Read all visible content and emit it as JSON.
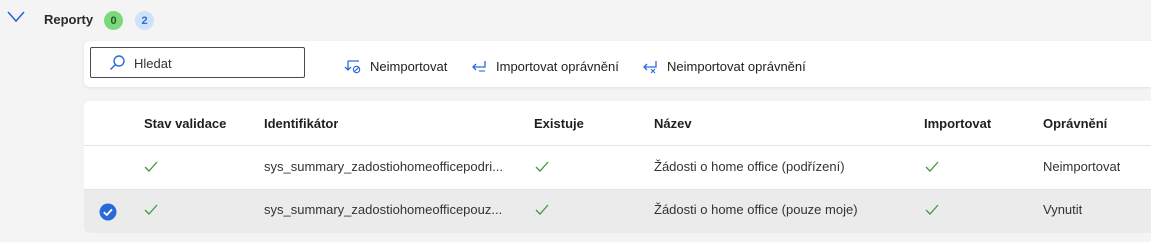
{
  "section": {
    "title": "Reporty",
    "badge_green": "0",
    "badge_blue": "2"
  },
  "toolbar": {
    "search_placeholder": "Hledat",
    "action_neimportovat": "Neimportovat",
    "action_importovat_opravneni": "Importovat oprávnění",
    "action_neimportovat_opravneni": "Neimportovat oprávnění"
  },
  "table": {
    "columns": [
      "Stav validace",
      "Identifikátor",
      "Existuje",
      "Název",
      "Importovat",
      "Oprávnění"
    ],
    "rows": [
      {
        "selected": false,
        "identifikator": "sys_summary_zadostiohomeofficepodri...",
        "nazev": "Žádosti o home office (podřízení)",
        "opravneni": "Neimportovat"
      },
      {
        "selected": true,
        "identifikator": "sys_summary_zadostiohomeofficepouz...",
        "nazev": "Žádosti o home office (pouze moje)",
        "opravneni": "Vynutit"
      }
    ]
  },
  "colors": {
    "accent_blue": "#2a6ad8",
    "check_green": "#3f9a3f",
    "badge_green_bg": "#7dd87d",
    "badge_blue_bg": "#cfe2fb"
  }
}
